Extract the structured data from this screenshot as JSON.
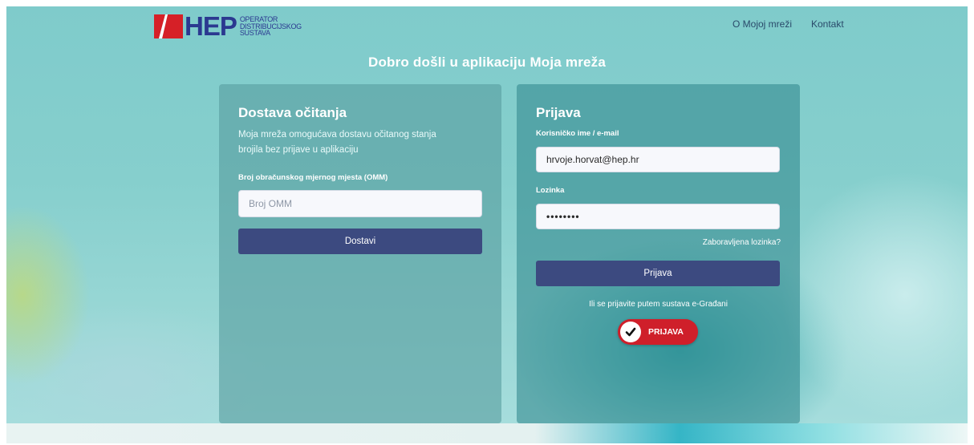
{
  "header": {
    "logo_text": "HEP",
    "logo_subtitle_1": "OPERATOR",
    "logo_subtitle_2": "DISTRIBUCIJSKOG",
    "logo_subtitle_3": "SUSTAVA",
    "nav": {
      "about": "O Mojoj mreži",
      "contact": "Kontakt"
    },
    "brand_color": "#2b3990",
    "brand_red": "#d62027"
  },
  "welcome": "Dobro došli u aplikaciju Moja mreža",
  "reading_card": {
    "title": "Dostava očitanja",
    "description_line1": "Moja mreža omogućava dostavu očitanog stanja",
    "description_line2": "brojila bez prijave u aplikaciju",
    "omm_label": "Broj obračunskog mjernog mjesta (OMM)",
    "omm_placeholder": "Broj OMM",
    "submit_label": "Dostavi"
  },
  "login_card": {
    "title": "Prijava",
    "username_label": "Korisničko ime / e-mail",
    "username_value": "hrvoje.horvat@hep.hr",
    "password_label": "Lozinka",
    "password_value": "••••••••",
    "forgot_password": "Zaboravljena lozinka?",
    "login_button": "Prijava",
    "egov_text": "Ili se prijavite putem sustava e-Građani",
    "egov_button": "PRIJAVA",
    "button_color": "#3c4a80",
    "egov_color": "#cf1f2a"
  }
}
